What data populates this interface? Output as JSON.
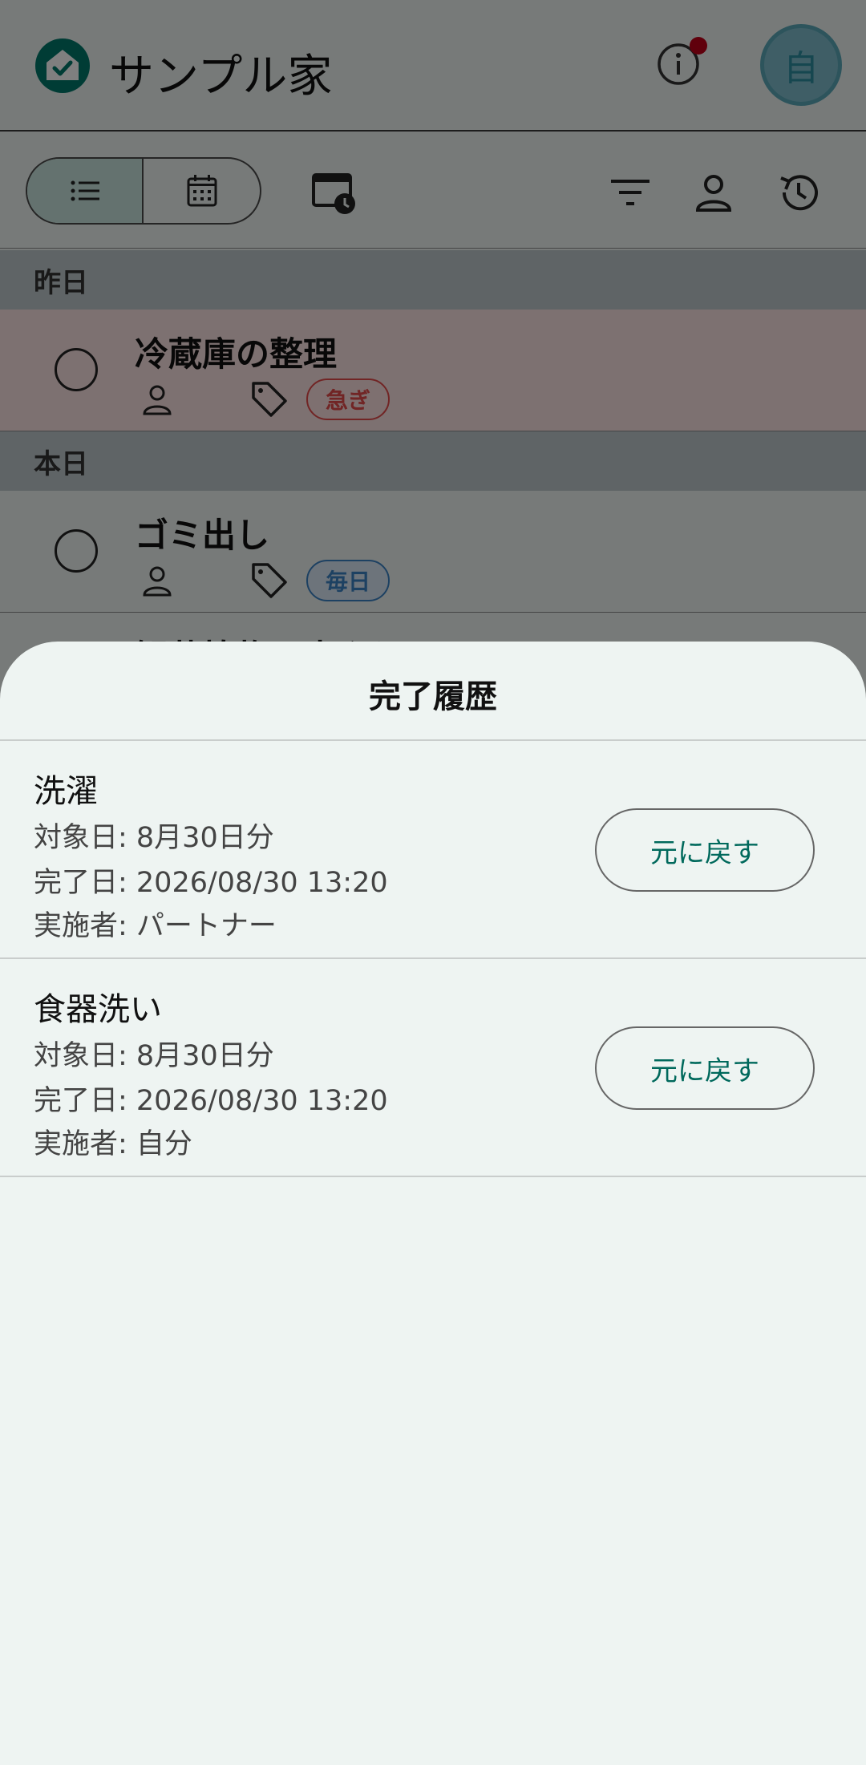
{
  "header": {
    "title": "サンプル家",
    "avatar_initial": "自"
  },
  "sections": [
    {
      "label": "昨日"
    },
    {
      "label": "本日"
    }
  ],
  "tasks": [
    {
      "title": "冷蔵庫の整理",
      "tag": "急ぎ",
      "status": "overdue"
    },
    {
      "title": "ゴミ出し",
      "tag": "毎日",
      "status": "today"
    },
    {
      "title": "観葉植物の水やり"
    }
  ],
  "sheet": {
    "title": "完了履歴",
    "restore_label": "元に戻す",
    "entries": [
      {
        "name": "洗濯",
        "target_date": "対象日: 8月30日分",
        "completed_at": "完了日: 2026/08/30 13:20",
        "performer": "実施者: パートナー"
      },
      {
        "name": "食器洗い",
        "target_date": "対象日: 8月30日分",
        "completed_at": "完了日: 2026/08/30 13:20",
        "performer": "実施者: 自分"
      }
    ]
  },
  "colors": {
    "accent": "#00695c",
    "urgent": "#e24a4a",
    "daily": "#3b82c4",
    "notification": "#c00018"
  }
}
